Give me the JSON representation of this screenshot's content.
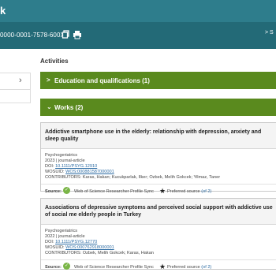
{
  "topbar": {
    "brand": "k"
  },
  "idbar": {
    "orcid": "0000-0001-7578-600X",
    "share_label": "S"
  },
  "activities": {
    "title": "Activities"
  },
  "sections": {
    "education": {
      "label": "Education and qualifications (1)"
    },
    "works": {
      "label": "Works (2)"
    }
  },
  "works": [
    {
      "title": "Addictive smartphone use in the elderly: relationship with depression, anxiety and sleep quality",
      "journal": "Psychogeriatrics",
      "meta": "2023 | journal-article",
      "doi_label": "DOI: ",
      "doi": "10.1111/PSYG.12910",
      "wosuid_label": "WOSUID: ",
      "wosuid": "WOS:000881587000001",
      "contributors": "CONTRIBUTORS: Karas, Hakan; Kucukparlak, Ilker; Ozbek, Melih Gokcek; Yilmaz, Taner",
      "source_label": "Source:",
      "source_name": "Web of Science Researcher Profile Sync",
      "preferred": "Preferred source",
      "preferred_of": "(of 2)"
    },
    {
      "title": "Associations of depressive symptoms and perceived social support with addictive use of social me elderly people in Turkey",
      "journal": "Psychogeriatrics",
      "meta": "2022 | journal-article",
      "doi_label": "DOI: ",
      "doi": "10.1111/PSYG.12770",
      "wosuid_label": "WOSUID: ",
      "wosuid": "WOS:000762918000001",
      "contributors": "CONTRIBUTORS: Ozbek, Melih Gokcek; Karas, Hakan",
      "source_label": "Source:",
      "source_name": "Web of Science Researcher Profile Sync",
      "preferred": "Preferred source",
      "preferred_of": "(of 2)"
    }
  ],
  "colors": {
    "header": "#2e7d8c",
    "section_bar": "#5a8a1e",
    "link": "#2e6da4"
  }
}
